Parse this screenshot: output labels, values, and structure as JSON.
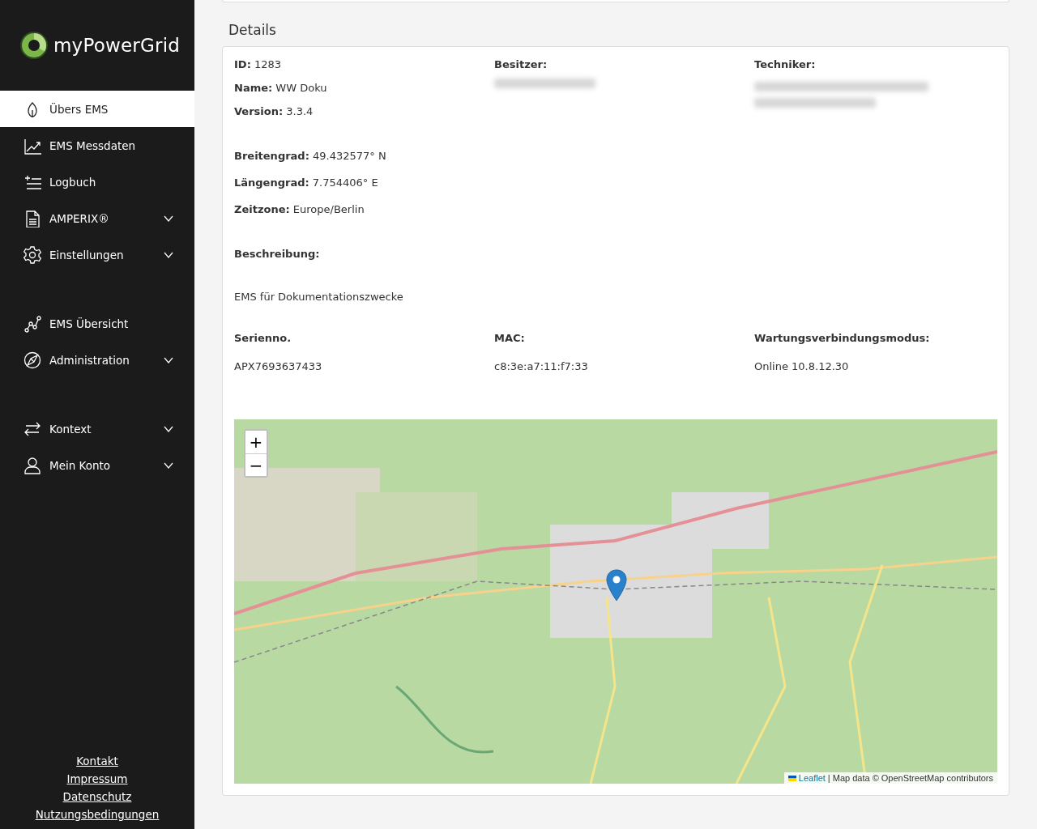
{
  "sidebar": {
    "brand": "myPowerGrid",
    "groups": [
      [
        {
          "label": "Übers EMS",
          "kind": "link",
          "selected": true
        },
        {
          "label": "EMS Messdaten",
          "kind": "link",
          "selected": false
        },
        {
          "label": "Logbuch",
          "kind": "link",
          "selected": false
        },
        {
          "label": "AMPERIX®",
          "kind": "menu",
          "expanded": false,
          "selected": false
        },
        {
          "label": "Einstellungen",
          "kind": "menu",
          "expanded": false,
          "selected": false
        }
      ],
      [
        {
          "label": "EMS Übersicht",
          "kind": "link",
          "selected": false
        },
        {
          "label": "Administration",
          "kind": "menu",
          "expanded": false,
          "selected": false
        }
      ],
      [
        {
          "label": "Kontext",
          "kind": "menu",
          "expanded": false,
          "selected": false
        },
        {
          "label": "Mein Konto",
          "kind": "menu",
          "expanded": false,
          "selected": false
        }
      ]
    ],
    "footer_links": [
      "Kontakt",
      "Impressum",
      "Datenschutz",
      "Nutzungsbedingungen"
    ]
  },
  "details": {
    "title": "Details",
    "identity": [
      {
        "label": "ID:",
        "value": "1283"
      },
      {
        "label": "Name:",
        "value": "WW Doku"
      },
      {
        "label": "Version:",
        "value": "3.3.4"
      }
    ],
    "owner": {
      "label": "Besitzer:"
    },
    "technician": {
      "label": "Techniker:"
    },
    "location": [
      {
        "label": "Breitengrad:",
        "value": "49.432577° N"
      },
      {
        "label": "Längengrad:",
        "value": "7.754406° E"
      },
      {
        "label": "Zeitzone:",
        "value": "Europe/Berlin"
      }
    ],
    "description": {
      "label": "Beschreibung:",
      "value": "EMS für Dokumentationszwecke"
    },
    "device": [
      {
        "label": "Serienno.",
        "value": "APX7693637433"
      },
      {
        "label": "MAC:",
        "value": "c8:3e:a7:11:f7:33"
      },
      {
        "label": "Wartungsverbindungsmodus:",
        "value": "Online 10.8.12.30"
      }
    ],
    "map": {
      "zoom_in": "+",
      "zoom_out": "−",
      "attribution_link": "Leaflet",
      "attribution": "| Map data © OpenStreetMap contributors"
    }
  }
}
